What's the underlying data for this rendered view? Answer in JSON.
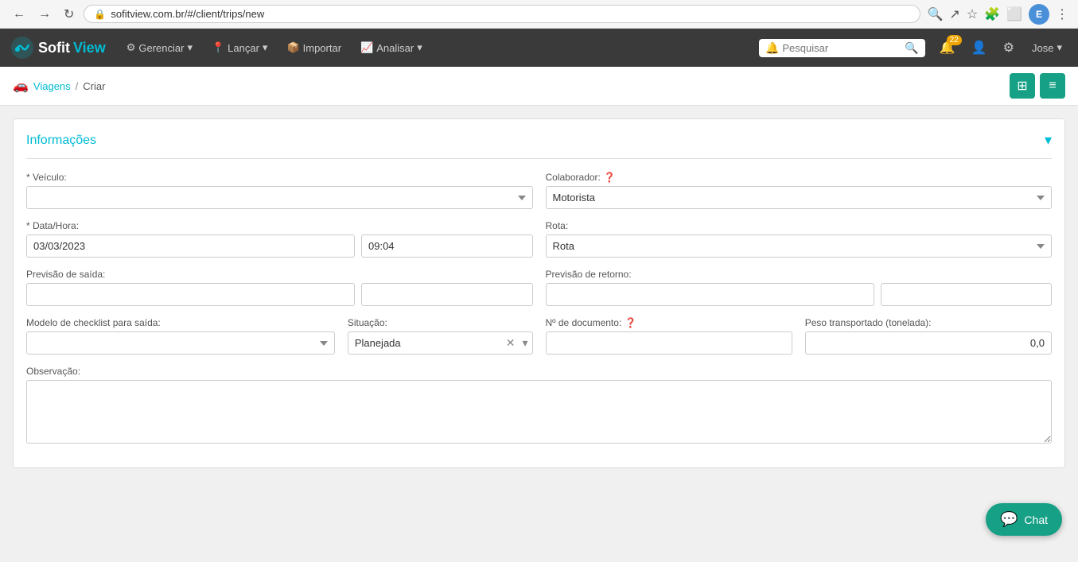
{
  "browser": {
    "url": "sofitview.com.br/#/client/trips/new",
    "back_btn": "←",
    "forward_btn": "→",
    "reload_btn": "↻",
    "user_avatar": "E"
  },
  "navbar": {
    "brand": {
      "sofit": "Sofit",
      "view": "View"
    },
    "menu": [
      {
        "label": "Gerenciar",
        "icon": "⚙"
      },
      {
        "label": "Lançar",
        "icon": "📍"
      },
      {
        "label": "Importar",
        "icon": "📦"
      },
      {
        "label": "Analisar",
        "icon": "📈"
      }
    ],
    "search_placeholder": "Pesquisar",
    "notification_count": "22",
    "user_name": "Jose"
  },
  "breadcrumb": {
    "icon": "🚗",
    "parent": "Viagens",
    "separator": "/",
    "current": "Criar"
  },
  "form": {
    "section_title": "Informações",
    "fields": {
      "veiculo_label": "* Veículo:",
      "colaborador_label": "Colaborador:",
      "colaborador_placeholder": "Motorista",
      "data_hora_label": "* Data/Hora:",
      "data_value": "03/03/2023",
      "hora_value": "09:04",
      "rota_label": "Rota:",
      "rota_placeholder": "Rota",
      "previsao_saida_label": "Previsão de saída:",
      "previsao_retorno_label": "Previsão de retorno:",
      "modelo_checklist_label": "Modelo de checklist para saída:",
      "situacao_label": "Situação:",
      "situacao_value": "Planejada",
      "ndocumento_label": "Nº de documento:",
      "peso_label": "Peso transportado (tonelada):",
      "peso_value": "0,0",
      "observacao_label": "Observação:"
    }
  },
  "chat": {
    "label": "Chat"
  }
}
